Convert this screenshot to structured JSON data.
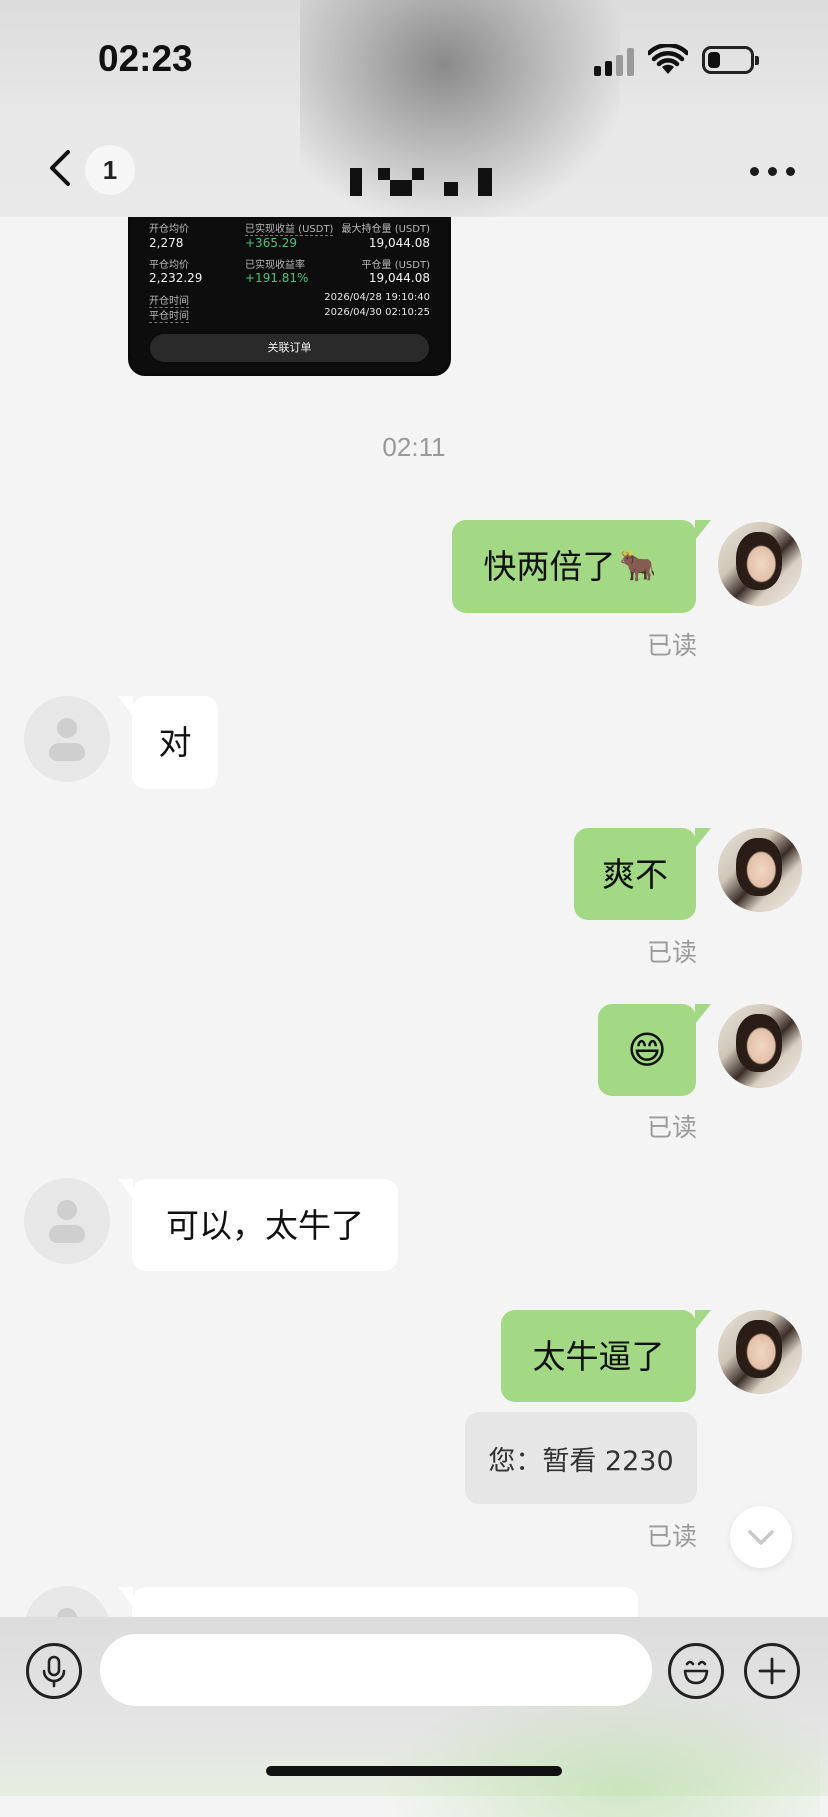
{
  "status_bar": {
    "time": "02:23"
  },
  "header": {
    "unread_count": "1"
  },
  "order_card": {
    "open_avg_label": "开仓均价",
    "open_avg_value": "2,278",
    "realized_pnl_label": "已实现收益 (USDT)",
    "realized_pnl_value": "+365.29",
    "max_position_label": "最大持仓量 (USDT)",
    "max_position_value": "19,044.08",
    "close_avg_label": "平仓均价",
    "close_avg_value": "2,232.29",
    "realized_rate_label": "已实现收益率",
    "realized_rate_value": "+191.81%",
    "closed_amount_label": "平仓量 (USDT)",
    "closed_amount_value": "19,044.08",
    "open_time_label": "开仓时间",
    "open_time_value": "2026/04/28 19:10:40",
    "close_time_label": "平仓时间",
    "close_time_value": "2026/04/30 02:10:25",
    "linked_order_button": "关联订单"
  },
  "timestamp": "02:11",
  "messages": [
    {
      "from": "me",
      "text": "快两倍了",
      "emoji": "🐂",
      "read": "已读"
    },
    {
      "from": "them",
      "text": "对"
    },
    {
      "from": "me",
      "text": "爽不",
      "read": "已读"
    },
    {
      "from": "me",
      "text": "😄",
      "read": "已读"
    },
    {
      "from": "them",
      "text": "可以，太牛了"
    },
    {
      "from": "me",
      "text": "太牛逼了",
      "quote": "您：暂看 2230",
      "read": "已读"
    }
  ],
  "colors": {
    "my_bubble": "#a3d884",
    "their_bubble": "#ffffff",
    "background": "#f4f4f4"
  },
  "icons": [
    "back-chevron-icon",
    "more-dots-icon",
    "microphone-icon",
    "emoji-icon",
    "plus-icon",
    "chevron-down-icon"
  ]
}
